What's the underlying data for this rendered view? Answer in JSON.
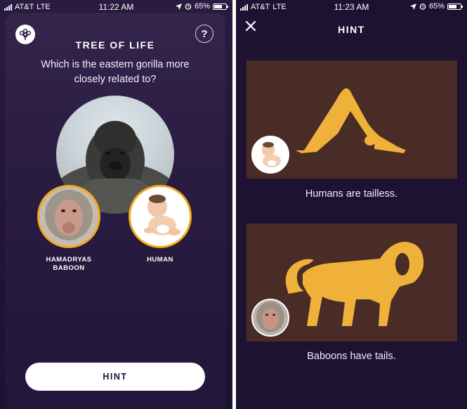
{
  "status_left": {
    "carrier": "AT&T",
    "network": "LTE",
    "time": "11:22 AM",
    "battery": "65%"
  },
  "status_right": {
    "carrier": "AT&T",
    "network": "LTE",
    "time": "11:23 AM",
    "battery": "65%"
  },
  "quiz": {
    "title": "TREE OF LIFE",
    "question": "Which is the eastern gorilla more closely related to?",
    "help_label": "?",
    "choices": [
      {
        "label": "HAMADRYAS BABOON"
      },
      {
        "label": "HUMAN"
      }
    ],
    "hint_button": "HINT"
  },
  "hint": {
    "title": "HINT",
    "panels": [
      {
        "caption": "Humans are tailless."
      },
      {
        "caption": "Baboons have tails."
      }
    ]
  },
  "colors": {
    "accent": "#f2a91c",
    "silhouette": "#f0b13a",
    "panel_bg": "#4a2c26",
    "screen_bg": "#1e1233"
  }
}
